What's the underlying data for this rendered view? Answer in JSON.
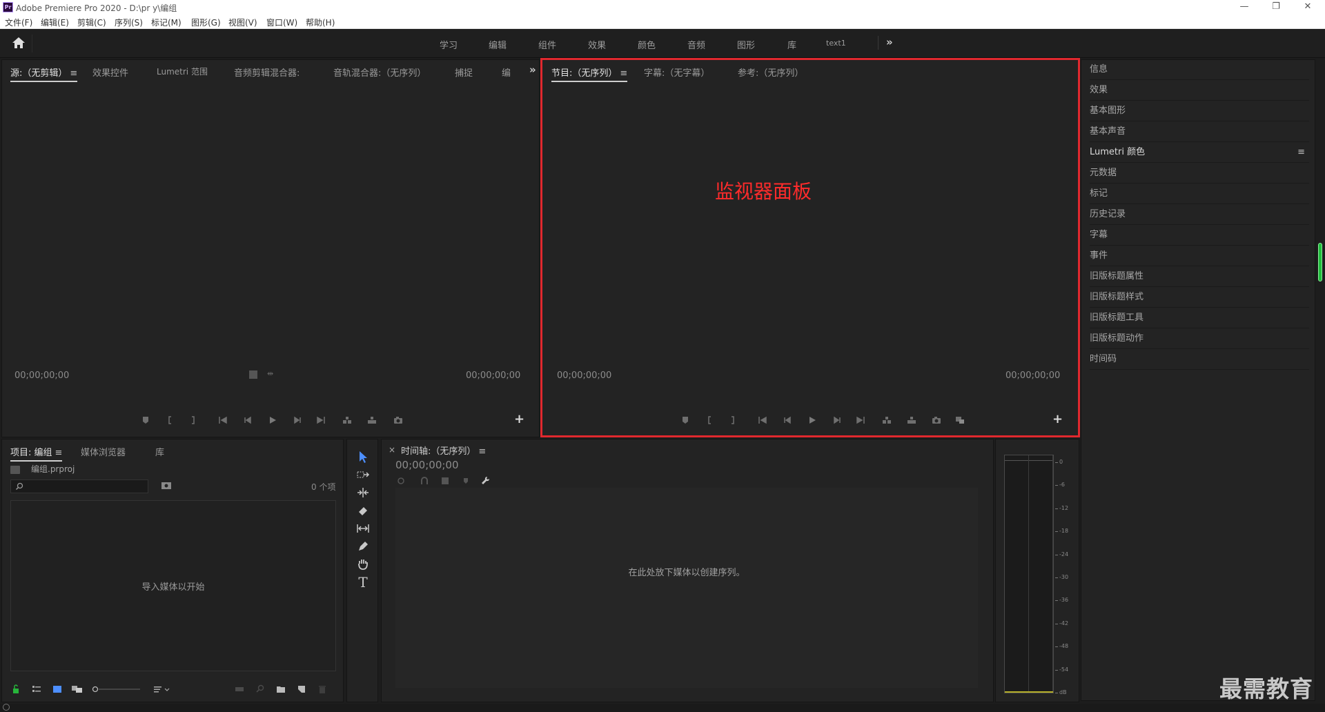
{
  "titlebar": {
    "logo": "Pr",
    "title": "Adobe Premiere Pro 2020 - D:\\pr y\\编组",
    "minimize": "—",
    "restore": "❐",
    "close": "✕"
  },
  "menubar": {
    "items": [
      "文件(F)",
      "编辑(E)",
      "剪辑(C)",
      "序列(S)",
      "标记(M)",
      "图形(G)",
      "视图(V)",
      "窗口(W)",
      "帮助(H)"
    ]
  },
  "workspaces": {
    "tabs": [
      "学习",
      "编辑",
      "组件",
      "效果",
      "颜色",
      "音频",
      "图形",
      "库",
      "text1"
    ],
    "more": "»"
  },
  "source_panel": {
    "tabs": [
      "源:（无剪辑）",
      "效果控件",
      "Lumetri 范围",
      "音频剪辑混合器:",
      "音轨混合器:（无序列）",
      "捕捉",
      "编"
    ],
    "more": "»",
    "timecode_in": "00;00;00;00",
    "timecode_out": "00;00;00;00",
    "add": "+"
  },
  "program_panel": {
    "tabs": [
      "节目:（无序列）",
      "字幕:（无字幕）",
      "参考:（无序列）"
    ],
    "timecode_in": "00;00;00;00",
    "timecode_out": "00;00;00;00",
    "add": "+",
    "annotation": "监视器面板",
    "annotation_color": "#ff2b2b"
  },
  "right_panel": {
    "items": [
      "信息",
      "效果",
      "基本图形",
      "基本声音",
      "Lumetri 颜色",
      "元数据",
      "标记",
      "历史记录",
      "字幕",
      "事件",
      "旧版标题属性",
      "旧版标题样式",
      "旧版标题工具",
      "旧版标题动作",
      "时间码"
    ],
    "menu_icon": "≡"
  },
  "project_panel": {
    "tabs": [
      "项目: 编组",
      "媒体浏览器",
      "库"
    ],
    "file_name": "编组.prproj",
    "item_count": "0 个项",
    "empty_message": "导入媒体以开始"
  },
  "timeline_panel": {
    "close": "×",
    "title": "时间轴:（无序列）",
    "timecode": "00;00;00;00",
    "empty_message": "在此处放下媒体以创建序列。"
  },
  "audio_meter": {
    "db_labels": [
      "0",
      "-6",
      "-12",
      "-18",
      "-24",
      "-30",
      "-36",
      "-42",
      "-48",
      "-54",
      "dB"
    ],
    "floor_color": "#b7b12a"
  },
  "tools": {
    "text_tool": "T",
    "active_color": "#4d8fff"
  },
  "watermark": "最需教育",
  "hamburger": "≡"
}
